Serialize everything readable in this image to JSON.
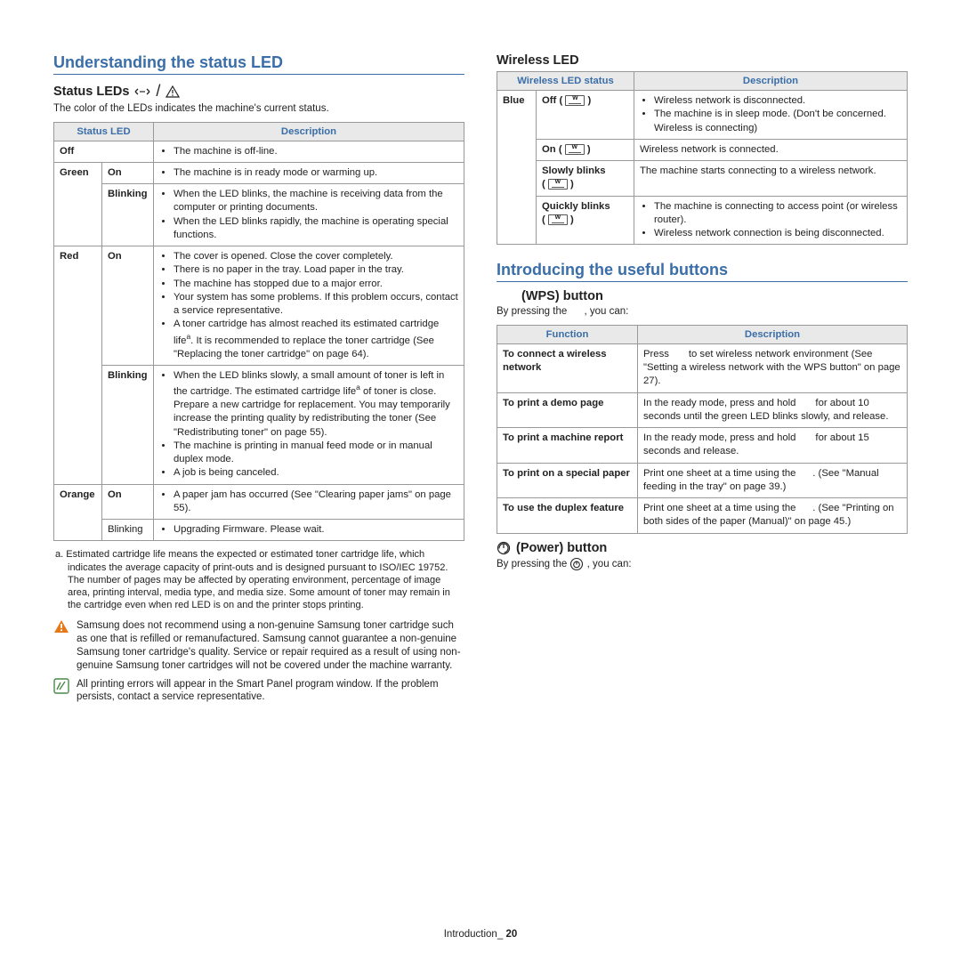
{
  "left": {
    "heading": "Understanding the status LED",
    "status_title": "Status LEDs",
    "status_intro": "The color of the LEDs indicates the machine's current status.",
    "th1": "Status LED",
    "th2": "Description",
    "rows": {
      "off_label": "Off",
      "off_desc": "The machine is off-line.",
      "green": "Green",
      "g_on": "On",
      "g_on_desc": "The machine is in ready mode or warming up.",
      "g_bl": "Blinking",
      "g_bl_d1": "When the LED blinks, the machine is receiving data from the computer or printing documents.",
      "g_bl_d2": "When the LED blinks rapidly, the machine is operating special functions.",
      "red": "Red",
      "r_on": "On",
      "r_on_d1": "The cover is opened. Close the cover completely.",
      "r_on_d2": "There is no paper in the tray. Load paper in the tray.",
      "r_on_d3": "The machine has stopped due to a major error.",
      "r_on_d4": "Your system has some problems. If this problem occurs, contact a service representative.",
      "r_on_d5a": "A toner cartridge has almost reached its estimated cartridge life",
      "r_on_d5b": ". It is recommended to replace the toner cartridge (See \"Replacing the toner cartridge\" on page 64).",
      "r_bl": "Blinking",
      "r_bl_d1a": "When the LED blinks slowly, a small amount of toner is left in the cartridge. The estimated cartridge life",
      "r_bl_d1b": " of toner is close. Prepare a new cartridge for replacement. You may temporarily increase the printing quality by redistributing the toner (See \"Redistributing toner\" on page 55).",
      "r_bl_d2": "The machine is printing in manual feed mode or in manual duplex mode.",
      "r_bl_d3": "A job is being canceled.",
      "orange": "Orange",
      "o_on": "On",
      "o_on_d": "A paper jam has occurred (See \"Clearing paper jams\" on page 55).",
      "o_bl": "Blinking",
      "o_bl_d": "Upgrading Firmware. Please wait."
    },
    "footnote": "a. Estimated cartridge life means the expected or estimated toner cartridge life, which indicates the average capacity of print-outs and is designed pursuant to ISO/IEC 19752. The number of pages may be affected by operating environment, percentage of image area, printing interval, media type, and media size. Some amount of toner may remain in the cartridge even when red LED is on and the printer stops printing.",
    "warn": "Samsung does not recommend using a non-genuine Samsung toner cartridge such as one that is refilled or remanufactured. Samsung cannot guarantee a non-genuine Samsung toner cartridge's quality. Service or repair required as a result of using non-genuine Samsung toner cartridges will not be covered under the machine warranty.",
    "note": "All printing errors will appear in the Smart Panel program window. If the problem persists, contact a service representative."
  },
  "right": {
    "wireless_title": "Wireless LED",
    "w_th1": "Wireless LED status",
    "w_th2": "Description",
    "blue": "Blue",
    "off_pre": "Off ( ",
    "off_post": " )",
    "off_d1": "Wireless network is disconnected.",
    "off_d2": "The machine is in sleep mode. (Don't be concerned. Wireless is connecting)",
    "on_pre": "On ( ",
    "on_post": " )",
    "on_d": "Wireless network is connected.",
    "slow": "Slowly blinks",
    "slow_sym_pre": "( ",
    "slow_sym_post": " )",
    "slow_d": "The machine starts connecting to a wireless network.",
    "quick": "Quickly blinks",
    "quick_sym_pre": "( ",
    "quick_sym_post": " )",
    "quick_d1": "The machine is connecting to access point (or wireless router).",
    "quick_d2": "Wireless network connection is being disconnected.",
    "intro_heading": "Introducing the useful buttons",
    "wps_title": "(WPS) button",
    "wps_intro_a": "By pressing the ",
    "wps_intro_b": ", you can:",
    "f_th1": "Function",
    "f_th2": "Description",
    "f1": "To connect a wireless network",
    "f1d_a": "Press ",
    "f1d_b": " to set wireless network environment (See \"Setting a wireless network with the WPS button\" on page 27).",
    "f2": "To print a demo page",
    "f2d_a": "In the ready mode, press and hold ",
    "f2d_b": " for about 10 seconds until the green LED blinks slowly, and release.",
    "f3": "To print a machine report",
    "f3d_a": "In the ready mode, press and hold ",
    "f3d_b": " for about 15 seconds and release.",
    "f4": "To print on a special paper",
    "f4d_a": "Print one sheet at a time using the ",
    "f4d_b": ". (See \"Manual feeding in the tray\" on page 39.)",
    "f5": "To use the duplex feature",
    "f5d_a": "Print one sheet at a time using the ",
    "f5d_b": ". (See \"Printing on both sides of the paper (Manual)\" on page 45.)",
    "power_title": "(Power) button",
    "power_intro_a": "By pressing the ",
    "power_intro_b": ", you can:"
  },
  "footer_label": "Introduction",
  "footer_page": "20"
}
